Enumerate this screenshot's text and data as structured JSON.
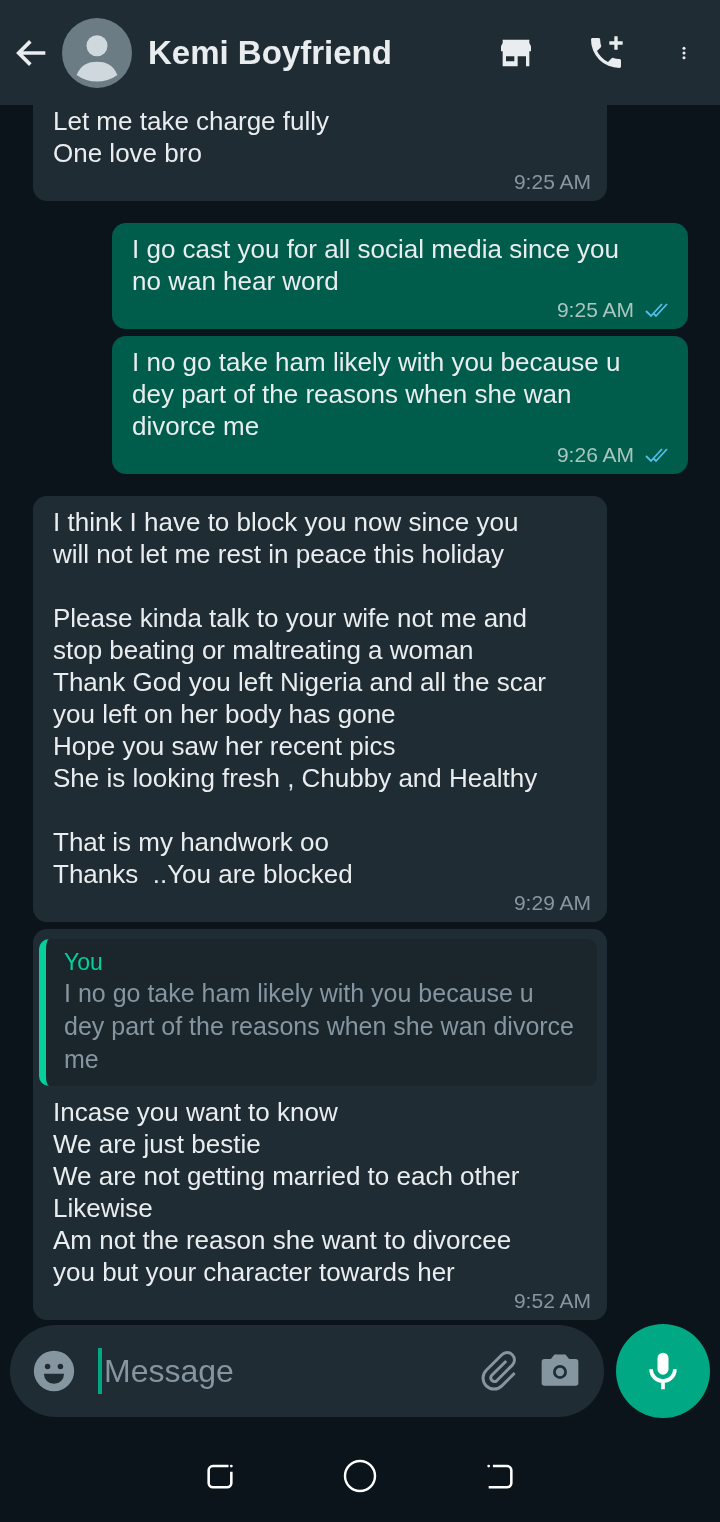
{
  "header": {
    "title": "Kemi Boyfriend"
  },
  "messages": [
    {
      "kind": "in",
      "text": "Let me take charge fully\nOne love bro",
      "time": "9:25 AM"
    },
    {
      "kind": "out",
      "text": "I go cast you for all social media since you no wan hear word",
      "time": "9:25 AM",
      "read": true
    },
    {
      "kind": "out",
      "text": "I no go take ham likely with you because u dey part of the reasons when she wan divorce me",
      "time": "9:26 AM",
      "read": true
    },
    {
      "kind": "in",
      "text": "I think I have to block you now since you will not let me rest in peace this holiday\n\nPlease kinda talk to your wife not me and stop beating or maltreating a woman\nThank God you left Nigeria and all the scar you left on her body has gone\nHope you saw her recent pics\nShe is looking fresh , Chubby and Healthy\n\nThat is my handwork oo\nThanks  ..You are blocked",
      "time": "9:29 AM"
    },
    {
      "kind": "in",
      "quote": {
        "author": "You",
        "text": "I no go take ham likely with you because u dey part of the reasons when she wan divorce me"
      },
      "text": "Incase you want to know\nWe are just bestie\nWe are not getting married to each other\nLikewise\nAm not the reason she want to divorcee you but your character towards her",
      "time": "9:52 AM"
    }
  ],
  "composer": {
    "placeholder": "Message"
  }
}
